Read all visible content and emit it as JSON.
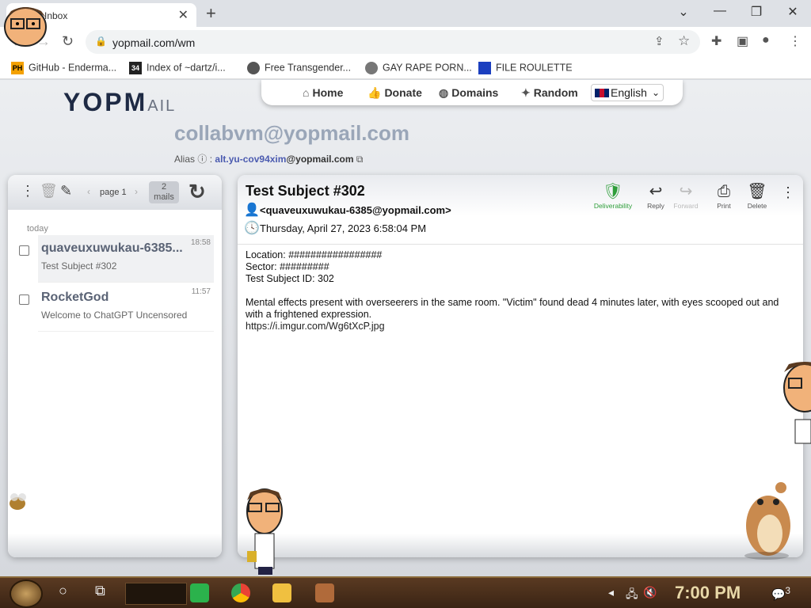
{
  "browser": {
    "tab_title": "Inbox",
    "url": "yopmail.com/wm",
    "bookmarks": [
      {
        "label": "GitHub - Enderma...",
        "icon": "PH"
      },
      {
        "label": "Index of ~dartz/i...",
        "icon": "34"
      },
      {
        "label": "Free Transgender...",
        "icon": ""
      },
      {
        "label": "GAY RAPE PORN...",
        "icon": ""
      },
      {
        "label": "FILE ROULETTE",
        "icon": ""
      }
    ]
  },
  "site": {
    "logo_main": "YOPM",
    "logo_sub": "AIL",
    "nav": [
      {
        "label": "Home"
      },
      {
        "label": "Donate"
      },
      {
        "label": "Domains"
      },
      {
        "label": "Random"
      }
    ],
    "language": "English",
    "email": "collabvm@yopmail.com",
    "alias_label": "Alias",
    "alias_id": "alt.yu-cov94xim",
    "alias_domain": "@yopmail.com"
  },
  "inbox": {
    "page_label": "page 1",
    "mail_count_num": "2",
    "mail_count_unit": "mails",
    "day_label": "today",
    "mails": [
      {
        "from": "quaveuxuwukau-6385...",
        "time": "18:58",
        "subject": "Test Subject #302"
      },
      {
        "from": "RocketGod",
        "time": "11:57",
        "subject": "Welcome to ChatGPT Uncensored"
      }
    ]
  },
  "message": {
    "subject": "Test Subject #302",
    "from": "<quaveuxuwukau-6385@yopmail.com>",
    "date": "Thursday, April 27, 2023 6:58:04 PM",
    "actions": {
      "deliverability": "Deliverability",
      "reply": "Reply",
      "forward": "Forward",
      "print": "Print",
      "delete": "Delete"
    },
    "body_lines": [
      "Location: #################",
      "Sector: #########",
      "Test Subject ID: 302",
      "",
      "Mental effects present with overseerers in the same room. \"Victim\" found dead 4 minutes later, with eyes scooped out and with a frightened expression.",
      "https://i.imgur.com/Wg6tXcP.jpg"
    ]
  },
  "taskbar": {
    "clock": "7:00 PM",
    "notification_count": "3"
  },
  "colors": {
    "accent_green": "#2e9e3a",
    "email_gray": "#9aa6b8",
    "alias_blue": "#4b5bb0"
  }
}
